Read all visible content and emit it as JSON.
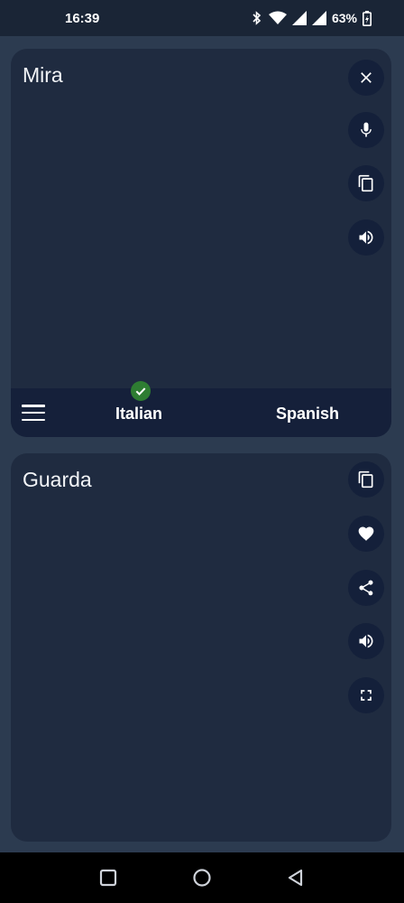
{
  "status_bar": {
    "time": "16:39",
    "battery": "63%"
  },
  "source_panel": {
    "text": "Mira",
    "buttons": [
      "close-icon",
      "microphone-icon",
      "copy-icon",
      "speaker-icon"
    ]
  },
  "language_bar": {
    "source_language": "Italian",
    "target_language": "Spanish",
    "selected": "Italian"
  },
  "target_panel": {
    "text": "Guarda",
    "buttons": [
      "copy-icon",
      "heart-icon",
      "share-icon",
      "speaker-icon",
      "fullscreen-icon"
    ]
  },
  "colors": {
    "background": "#2c3b50",
    "card": "#1f2b40",
    "button": "#14203a",
    "check": "#2e7d32"
  }
}
